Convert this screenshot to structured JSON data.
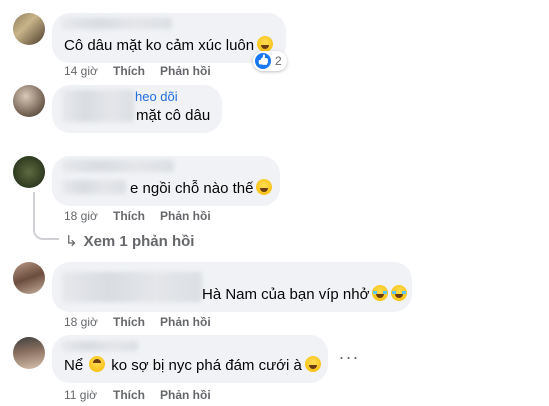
{
  "comments": [
    {
      "text": "Cô dâu mặt ko cảm xúc luôn",
      "time": "14 giờ",
      "like_label": "Thích",
      "reply_label": "Phản hồi",
      "reaction_count": "2",
      "reaction_icon": "like-icon"
    },
    {
      "mention": "heo dõi",
      "text": "mặt cô dâu",
      "time": "",
      "like_label": "",
      "reply_label": ""
    },
    {
      "text": "e ngồi chỗ nào thế",
      "time": "18 giờ",
      "like_label": "Thích",
      "reply_label": "Phản hồi"
    },
    {
      "text": "Hà Nam của bạn víp nhở",
      "time": "18 giờ",
      "like_label": "Thích",
      "reply_label": "Phản hồi"
    },
    {
      "text_before": "Nể",
      "text": "ko sợ bị nyc phá đám cưới à",
      "time": "11 giờ",
      "like_label": "Thích",
      "reply_label": "Phản hồi"
    }
  ],
  "view_replies": "Xem 1 phản hồi",
  "more_options": "···",
  "colors": {
    "bubble": "#f0f2f5",
    "meta": "#65676b",
    "mention": "#216fdb",
    "like": "#1877f2"
  }
}
